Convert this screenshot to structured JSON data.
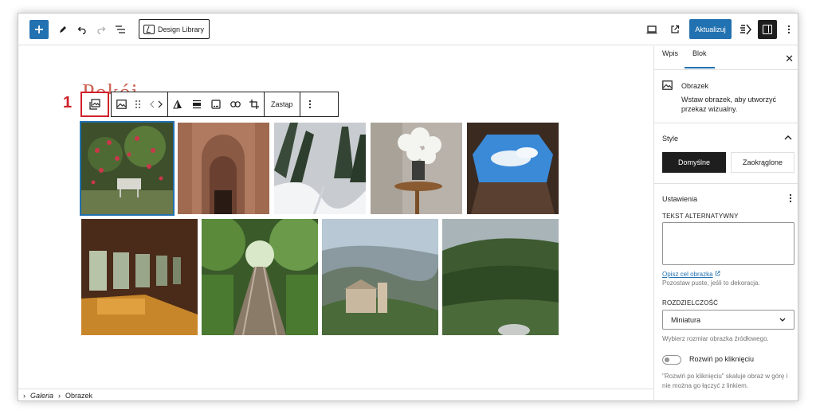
{
  "toolbar": {
    "design_library_label": "Design Library",
    "update_label": "Aktualizuj"
  },
  "canvas": {
    "ghost_title": "Pokój ...",
    "marker_number": "1",
    "block_toolbar": {
      "replace_label": "Zastąp"
    }
  },
  "breadcrumb": {
    "items": [
      "Galeria",
      "Obrazek"
    ]
  },
  "sidebar": {
    "tabs": [
      "Wpis",
      "Blok"
    ],
    "active_tab": "Blok",
    "block": {
      "name": "Obrazek",
      "description": "Wstaw obrazek, aby utworzyć przekaz wizualny."
    },
    "style": {
      "title": "Style",
      "options": [
        "Domyślne",
        "Zaokrąglone"
      ],
      "selected": "Domyślne"
    },
    "settings": {
      "title": "Ustawienia",
      "alt_label": "TEKST ALTERNATYWNY",
      "alt_value": "",
      "alt_link": "Opisz cel obrazka",
      "alt_help": "Pozostaw puste, jeśli to dekoracja.",
      "resolution_label": "ROZDZIELCZOŚĆ",
      "resolution_value": "Miniatura",
      "resolution_help": "Wybierz rozmiar obrazka źródłowego.",
      "expand_label": "Rozwiń po kliknięciu",
      "expand_enabled": false,
      "expand_help": "\"Rozwiń po kliknięciu\" skaluje obraz w górę i nie można go łączyć z linkiem."
    }
  },
  "colors": {
    "accent": "#2271b1",
    "marker": "#d0202a"
  }
}
